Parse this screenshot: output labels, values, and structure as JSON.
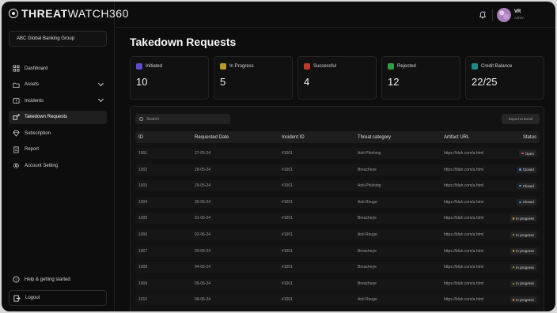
{
  "brand": {
    "bold": "THREAT",
    "light": "WATCH360"
  },
  "org": "ABC Global Banking Group",
  "nav": [
    {
      "label": "Dashboard",
      "icon": "grid-icon",
      "chevron": false
    },
    {
      "label": "Assets",
      "icon": "folder-icon",
      "chevron": true
    },
    {
      "label": "Incidents",
      "icon": "alert-icon",
      "chevron": true
    },
    {
      "label": "Takedown Requests",
      "icon": "takedown-icon",
      "chevron": false,
      "active": true
    },
    {
      "label": "Subscription",
      "icon": "diamond-icon",
      "chevron": false
    },
    {
      "label": "Report",
      "icon": "document-icon",
      "chevron": false
    },
    {
      "label": "Account Setting",
      "icon": "gear-icon",
      "chevron": false
    }
  ],
  "help_label": "Help & getting started",
  "logout_label": "Logout",
  "user": {
    "initials": "VR",
    "role": "Admin"
  },
  "page_title": "Takedown Requests",
  "cards": [
    {
      "label": "Initiated",
      "value": "10",
      "color": "#5b4bd1"
    },
    {
      "label": "In Progress",
      "value": "5",
      "color": "#b99b2a"
    },
    {
      "label": "Successful",
      "value": "4",
      "color": "#c0392b"
    },
    {
      "label": "Rejected",
      "value": "12",
      "color": "#2f9e44"
    },
    {
      "label": "Credit Balance",
      "value": "22/25",
      "color": "#1f8a8a"
    }
  ],
  "search_placeholder": "Search",
  "export_label": "Export to Excel",
  "columns": [
    "ID",
    "Requested Date",
    "Incident ID",
    "Threat category",
    "Artifact URL",
    "Status"
  ],
  "rows": [
    {
      "id": "1001",
      "date": "27-05-24",
      "incident": "#1001",
      "category": "Anti-Phishing",
      "url": "https://blah.com/a.html",
      "status": "Open",
      "dot": "#e0525a"
    },
    {
      "id": "1002",
      "date": "28-05-24",
      "incident": "#1001",
      "category": "Breacheye",
      "url": "https://blah.com/a.html",
      "status": "Closed",
      "dot": "#4a8fe0"
    },
    {
      "id": "1003",
      "date": "29-05-24",
      "incident": "#1001",
      "category": "Anti-Phishing",
      "url": "https://blah.com/a.html",
      "status": "Closed",
      "dot": "#4a8fe0"
    },
    {
      "id": "1004",
      "date": "30-05-24",
      "incident": "#1001",
      "category": "Anti Rouge",
      "url": "https://blah.com/a.html",
      "status": "Closed",
      "dot": "#4a8fe0"
    },
    {
      "id": "1005",
      "date": "01-06-24",
      "incident": "#1001",
      "category": "Breacheye",
      "url": "https://blah.com/a.html",
      "status": "In progress",
      "dot": "#e0a030"
    },
    {
      "id": "1006",
      "date": "02-06-24",
      "incident": "#1001",
      "category": "Anti Rouge",
      "url": "https://blah.com/a.html",
      "status": "In progress",
      "dot": "#e0a030"
    },
    {
      "id": "1007",
      "date": "03-06-24",
      "incident": "#1001",
      "category": "Breacheye",
      "url": "https://blah.com/a.html",
      "status": "In progress",
      "dot": "#e0a030"
    },
    {
      "id": "1008",
      "date": "04-06-24",
      "incident": "#1001",
      "category": "Breacheye",
      "url": "https://blah.com/a.html",
      "status": "In progress",
      "dot": "#e0a030"
    },
    {
      "id": "1009",
      "date": "05-06-24",
      "incident": "#1001",
      "category": "Breacheye",
      "url": "https://blah.com/a.html",
      "status": "In progress",
      "dot": "#e0a030"
    },
    {
      "id": "1010",
      "date": "06-06-24",
      "incident": "#1001",
      "category": "Anti Rouge",
      "url": "https://blah.com/a.html",
      "status": "In progress",
      "dot": "#e0a030"
    }
  ]
}
